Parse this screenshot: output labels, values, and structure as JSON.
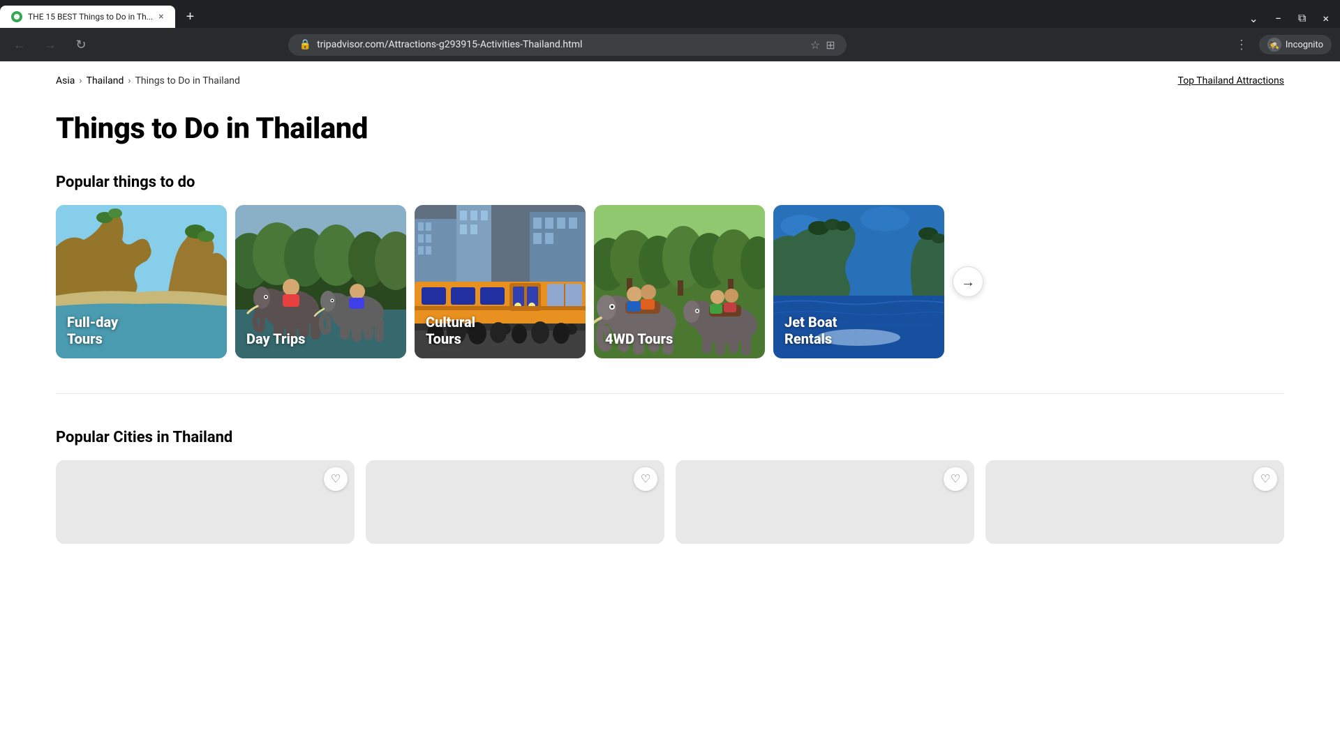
{
  "browser": {
    "tab_title": "THE 15 BEST Things to Do in Th...",
    "url": "tripadvisor.com/Attractions-g293915-Activities-Thailand.html",
    "incognito_label": "Incognito"
  },
  "breadcrumb": {
    "items": [
      "Asia",
      "Thailand",
      "Things to Do in Thailand"
    ],
    "right_link": "Top Thailand Attractions"
  },
  "page": {
    "title": "Things to Do in Thailand",
    "popular_section_title": "Popular things to do",
    "cities_section_title": "Popular Cities in Thailand"
  },
  "activity_cards": [
    {
      "id": "full-day-tours",
      "label": "Full-day Tours"
    },
    {
      "id": "day-trips",
      "label": "Day Trips"
    },
    {
      "id": "cultural-tours",
      "label": "Cultural Tours"
    },
    {
      "id": "4wd-tours",
      "label": "4WD Tours"
    },
    {
      "id": "jet-boat-rentals",
      "label": "Jet Boat\nRentals"
    }
  ],
  "city_cards": [
    {
      "id": "city-1"
    },
    {
      "id": "city-2"
    },
    {
      "id": "city-3"
    },
    {
      "id": "city-4"
    }
  ],
  "icons": {
    "back_arrow": "←",
    "forward_arrow": "→",
    "refresh": "↻",
    "lock": "🔒",
    "star": "☆",
    "extensions": "⊞",
    "incognito": "🕵",
    "close_tab": "×",
    "new_tab": "+",
    "chevron_right": "›",
    "next_arrow": "→",
    "heart": "♡",
    "minimize": "−",
    "maximize": "⧉",
    "close_window": "×",
    "list": "⋮",
    "tab_list": "⌄"
  }
}
